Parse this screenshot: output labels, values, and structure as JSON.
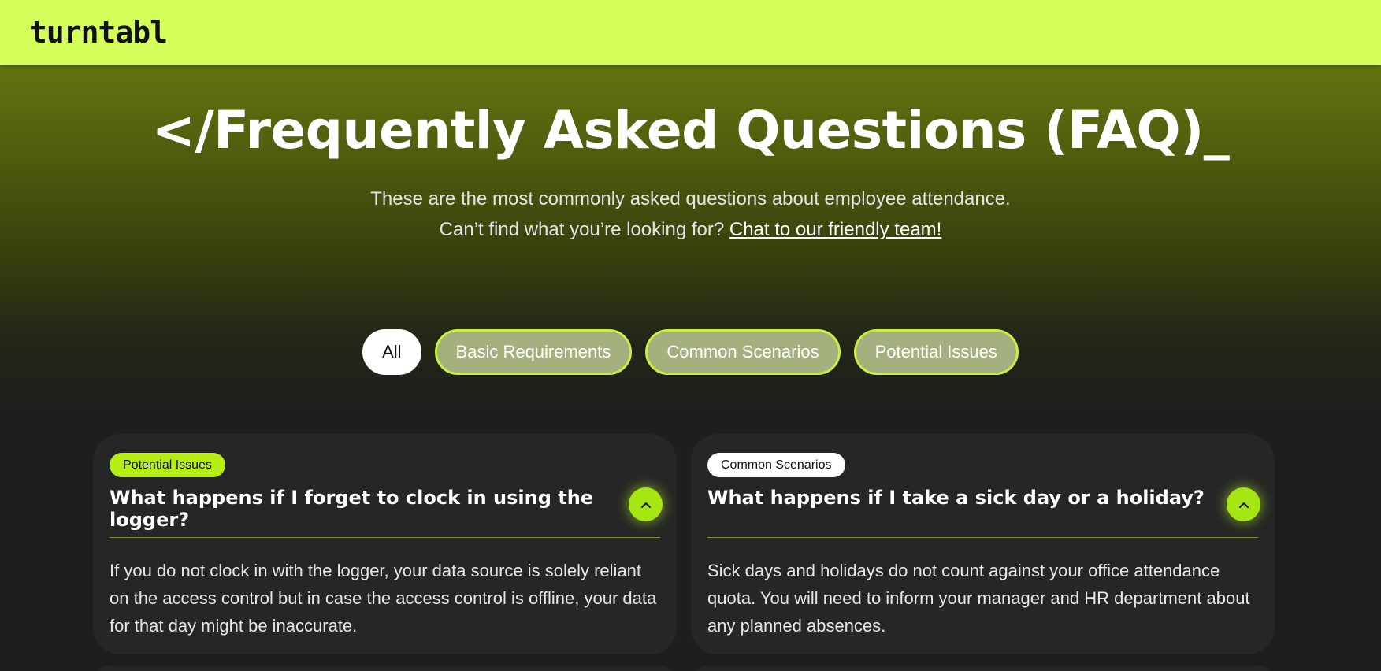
{
  "header": {
    "logo_text": "turntabl"
  },
  "hero": {
    "title": "</Frequently Asked Questions (FAQ)_",
    "subtitle_line1": "These are the most commonly asked questions about employee attendance.",
    "subtitle_line2_prefix": "Can’t find what you’re looking for? ",
    "subtitle_link": "Chat to our friendly team!"
  },
  "filters": [
    {
      "label": "All",
      "active": true
    },
    {
      "label": "Basic Requirements",
      "active": false
    },
    {
      "label": "Common Scenarios",
      "active": false
    },
    {
      "label": "Potential Issues",
      "active": false
    }
  ],
  "faqs": [
    {
      "tag": "Potential Issues",
      "question": "What happens if I forget to clock in using the logger?",
      "answer": "If you do not clock in with the logger, your data source is solely reliant on the access control but in case the access control is offline, your data for that day might be inaccurate.",
      "toggle_icon": "chevron-up-icon"
    },
    {
      "tag": "Common Scenarios",
      "question": "What happens if I take a sick day or a holiday?",
      "answer": "Sick days and holidays do not count against your office attendance quota. You will need to inform your manager and HR department about any planned absences.",
      "toggle_icon": "chevron-up-icon"
    }
  ],
  "colors": {
    "accent": "#d4ff5a",
    "tag_green": "#b5ee14",
    "card_bg": "#262626",
    "page_bg": "#1e1e1e"
  }
}
